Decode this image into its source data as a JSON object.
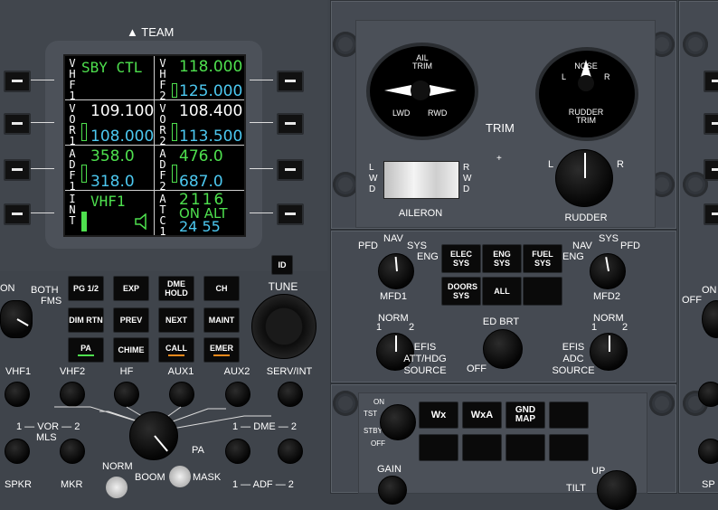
{
  "team_label": "TEAM",
  "lsk_rows": 4,
  "screen": {
    "row1": {
      "left_label": "VHF1",
      "left_value": "SBY CTL",
      "right_label": "VHF2",
      "right_active": "118.000",
      "right_standby": "125.000"
    },
    "row2": {
      "left_label": "VOR1",
      "left_active": "109.100",
      "left_standby": "108.000",
      "right_label": "VOR2",
      "right_active": "108.400",
      "right_standby": "113.500"
    },
    "row3": {
      "left_label": "ADF1",
      "left_active": "358.0",
      "left_standby": "318.0",
      "right_label": "ADF2",
      "right_active": "476.0",
      "right_standby": "687.0"
    },
    "row4": {
      "left_label": "INT",
      "left_value": "VHF1",
      "right_label": "ATC1",
      "right_code": "2116",
      "right_mode": "ON ALT",
      "right_standby": "24 55"
    }
  },
  "keys": [
    [
      "PG 1/2",
      "EXP",
      "DME HOLD",
      "CH"
    ],
    [
      "DIM RTN",
      "PREV",
      "NEXT",
      "MAINT"
    ],
    [
      "PA",
      "CHIME",
      "CALL",
      "EMER"
    ]
  ],
  "id_button": "ID",
  "tune_label": "TUNE",
  "fms_knob": {
    "on": "ON",
    "both": "BOTH",
    "fms": "FMS"
  },
  "audio_labels": [
    "VHF1",
    "VHF2",
    "HF",
    "AUX1",
    "AUX2",
    "SERV/INT"
  ],
  "audio_row2": {
    "vor_left": "1",
    "vor": "VOR",
    "vor_right": "2",
    "mls": "MLS",
    "dme_left": "1",
    "dme": "DME",
    "dme_right": "2",
    "pa": "PA"
  },
  "audio_row3": {
    "spkr": "SPKR",
    "mkr": "MKR",
    "norm": "NORM",
    "boom": "BOOM",
    "mask": "MASK",
    "adf_left": "1",
    "adf": "ADF",
    "adf_right": "2"
  },
  "trim": {
    "ail_trim_title": "AIL TRIM",
    "ail_lwd": "LWD",
    "ail_rwd": "RWD",
    "nose": "NOSE",
    "rudder_l": "L",
    "rudder_r": "R",
    "rudder_trim": "RUDDER TRIM",
    "trim_label": "TRIM",
    "lwd_vertical": "LWD",
    "rwd_vertical": "RWD",
    "aileron": "AILERON",
    "rudder": "RUDDER",
    "rudder_knob_l": "L",
    "rudder_knob_r": "R",
    "plus": "+"
  },
  "mfd": {
    "mfd1": {
      "pfd": "PFD",
      "nav": "NAV",
      "sys": "SYS",
      "eng": "ENG",
      "label": "MFD1"
    },
    "mfd2": {
      "nav": "NAV",
      "sys": "SYS",
      "pfd": "PFD",
      "eng": "ENG",
      "label": "MFD2"
    },
    "buttons": [
      "ELEC SYS",
      "ENG SYS",
      "FUEL SYS",
      "DOORS SYS",
      "ALL",
      ""
    ]
  },
  "efis": {
    "left": {
      "norm": "NORM",
      "one": "1",
      "two": "2",
      "line1": "EFIS",
      "line2": "ATT/HDG",
      "line3": "SOURCE"
    },
    "ed_brt": "ED BRT",
    "off": "OFF",
    "right": {
      "norm": "NORM",
      "one": "1",
      "two": "2",
      "line1": "EFIS",
      "line2": "ADC",
      "line3": "SOURCE"
    }
  },
  "wx": {
    "on": "ON",
    "tst": "TST",
    "stby": "STBY",
    "off": "OFF",
    "buttons": [
      "Wx",
      "WxA",
      "GND MAP",
      "",
      "",
      "",
      "",
      ""
    ],
    "gain": "GAIN",
    "tilt": "TILT",
    "up": "UP"
  },
  "right_edge": {
    "on": "ON",
    "off": "OFF",
    "sp": "SP"
  }
}
